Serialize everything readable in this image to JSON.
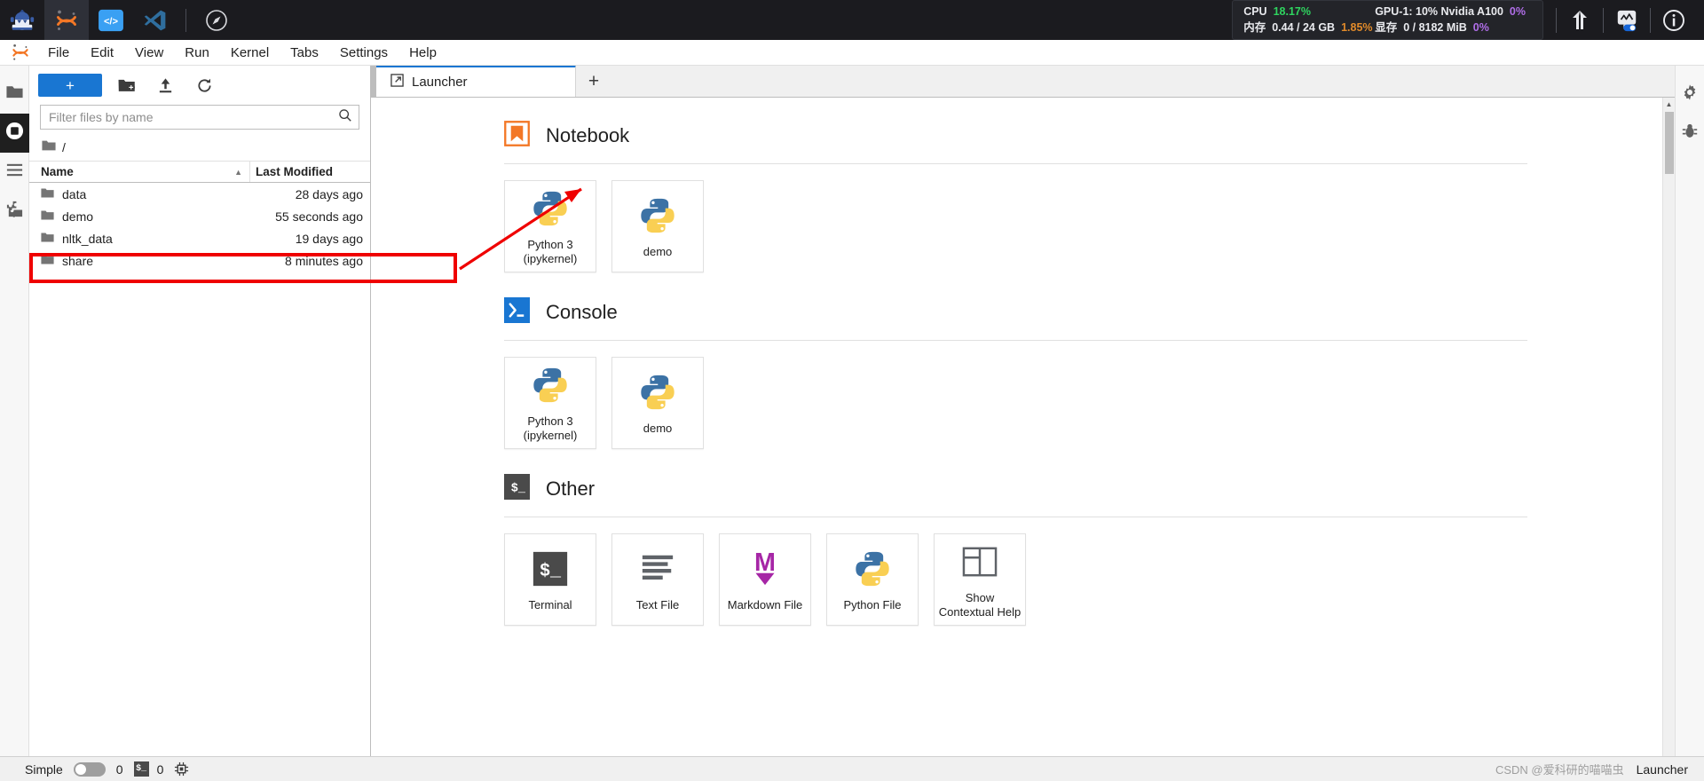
{
  "topbar": {
    "left_icons": [
      {
        "name": "ai-assistant-icon",
        "title": "AI Assistant"
      },
      {
        "name": "jupyter-logo-icon",
        "title": "Jupyter"
      },
      {
        "name": "code-server-icon",
        "title": "Code Server"
      },
      {
        "name": "vscode-icon",
        "title": "VS Code"
      },
      {
        "name": "compass-icon",
        "title": "Explore"
      }
    ],
    "resources": {
      "cpu_label": "CPU",
      "cpu_value": "18.17%",
      "mem_label": "内存",
      "mem_value": "0.44 / 24 GB",
      "mem_percent": "1.85%",
      "gpu_label": "GPU-1: 10% Nvidia A100",
      "gpu_percent": "0%",
      "vram_label": "显存",
      "vram_value": "0 / 8182 MiB",
      "vram_percent": "0%"
    },
    "right_icons": [
      {
        "name": "upload-arrow-icon",
        "title": "Upload"
      },
      {
        "name": "monitor-toggle-icon",
        "title": "Resource Monitor"
      },
      {
        "name": "info-icon",
        "title": "Info"
      }
    ]
  },
  "menubar": {
    "items": [
      "File",
      "Edit",
      "View",
      "Run",
      "Kernel",
      "Tabs",
      "Settings",
      "Help"
    ]
  },
  "left_rail": {
    "items": [
      {
        "name": "sidebar-item-file-browser",
        "icon": "folder-icon",
        "selected": false
      },
      {
        "name": "sidebar-item-running",
        "icon": "stop-square-icon",
        "selected": true
      },
      {
        "name": "sidebar-item-toc",
        "icon": "list-icon",
        "selected": false
      },
      {
        "name": "sidebar-item-extensions",
        "icon": "puzzle-icon",
        "selected": false
      }
    ]
  },
  "right_rail": {
    "items": [
      {
        "name": "sidebar-item-property-inspector",
        "icon": "gear-icon"
      },
      {
        "name": "sidebar-item-debugger",
        "icon": "bug-icon"
      }
    ]
  },
  "filebrowser": {
    "new_button_label": "+",
    "toolbar_icons": [
      {
        "name": "new-folder-icon",
        "title": "New Folder"
      },
      {
        "name": "upload-icon",
        "title": "Upload Files"
      },
      {
        "name": "refresh-icon",
        "title": "Refresh File List"
      }
    ],
    "filter": {
      "placeholder": "Filter files by name",
      "value": "",
      "icon": "search-icon"
    },
    "breadcrumb": "/",
    "columns": {
      "name": "Name",
      "last_modified": "Last Modified"
    },
    "sort_indicator": "▲",
    "rows": [
      {
        "name": "data",
        "modified": "28 days ago",
        "highlighted": false
      },
      {
        "name": "demo",
        "modified": "55 seconds ago",
        "highlighted": true
      },
      {
        "name": "nltk_data",
        "modified": "19 days ago",
        "highlighted": false
      },
      {
        "name": "share",
        "modified": "8 minutes ago",
        "highlighted": false
      }
    ]
  },
  "tabbar": {
    "tabs": [
      {
        "label": "Launcher",
        "icon": "launcher-icon",
        "active": true
      }
    ],
    "add_tab_label": "+"
  },
  "launcher": {
    "sections": [
      {
        "id": "notebook",
        "title": "Notebook",
        "icon": "notebook-bookmark-icon",
        "cards": [
          {
            "label": "Python 3\n(ipykernel)",
            "icon": "python-icon"
          },
          {
            "label": "demo",
            "icon": "python-icon"
          }
        ]
      },
      {
        "id": "console",
        "title": "Console",
        "icon": "console-prompt-icon",
        "cards": [
          {
            "label": "Python 3\n(ipykernel)",
            "icon": "python-icon"
          },
          {
            "label": "demo",
            "icon": "python-icon"
          }
        ]
      },
      {
        "id": "other",
        "title": "Other",
        "icon": "terminal-prompt-icon",
        "cards": [
          {
            "label": "Terminal",
            "icon": "terminal-icon"
          },
          {
            "label": "Text File",
            "icon": "text-file-icon"
          },
          {
            "label": "Markdown File",
            "icon": "markdown-icon"
          },
          {
            "label": "Python File",
            "icon": "python-icon"
          },
          {
            "label": "Show Contextual Help",
            "icon": "contextual-help-icon"
          }
        ]
      }
    ]
  },
  "statusbar": {
    "simple_label": "Simple",
    "simple_on": false,
    "kernel_count": "0",
    "terminal_count": "0",
    "terminal_icon": "terminal-small-icon",
    "cpu_icon": "chip-icon",
    "launcher_label": "Launcher",
    "watermark": "CSDN @爱科研的喵喵虫"
  },
  "colors": {
    "accent_blue": "#1976d2",
    "jupyter_orange": "#f37726",
    "highlight_red": "#ef0000",
    "dark_bg": "#1b1b1f"
  }
}
